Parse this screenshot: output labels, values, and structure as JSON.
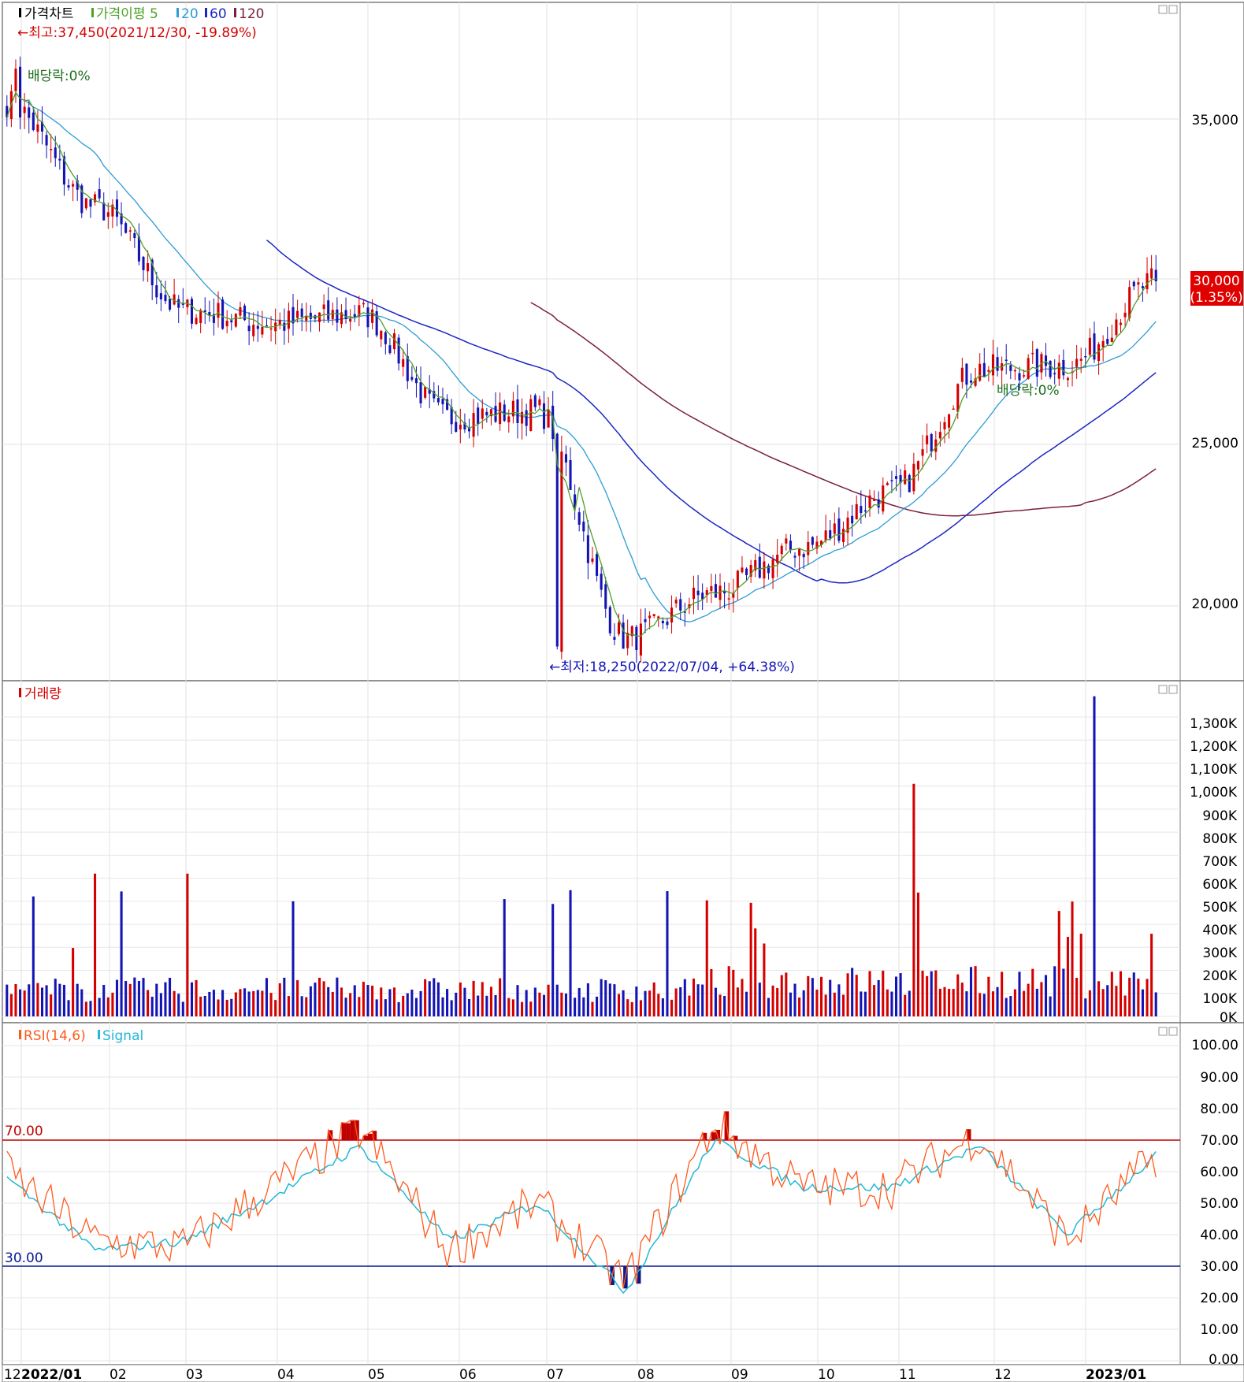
{
  "panes": {
    "price": {
      "title": "가격차트",
      "legend": [
        "가격이평 5",
        "20",
        "60",
        "120"
      ],
      "legend_colors": [
        "#4fa028",
        "#2e9bd6",
        "#1c25c4",
        "#7a1f3d"
      ],
      "high_note": "←최고:37,450(2021/12/30, -19.89%)",
      "low_note": "←최저:18,250(2022/07/04, +64.38%)",
      "dividend_note_1": "배당락:0%",
      "dividend_note_2": "배당락:0%",
      "current_price": "30,000",
      "current_change": "(1.35%)",
      "y_ticks": [
        "35,000",
        "25,000",
        "20,000"
      ]
    },
    "volume": {
      "title": "거래량",
      "y_ticks": [
        "1,300K",
        "1,200K",
        "1,100K",
        "1,000K",
        "900K",
        "800K",
        "700K",
        "600K",
        "500K",
        "400K",
        "300K",
        "200K",
        "100K",
        "0K"
      ]
    },
    "rsi": {
      "title": "RSI(14,6)",
      "signal_label": "Signal",
      "upper_label": "70.00",
      "lower_label": "30.00",
      "y_ticks": [
        "100.00",
        "90.00",
        "80.00",
        "70.00",
        "60.00",
        "50.00",
        "40.00",
        "30.00",
        "20.00",
        "10.00",
        "0.00"
      ]
    }
  },
  "x_axis": {
    "labels": [
      "12",
      "2022/01",
      "02",
      "03",
      "04",
      "05",
      "06",
      "07",
      "08",
      "09",
      "10",
      "11",
      "12",
      "2023/01"
    ]
  },
  "colors": {
    "up": "#d40000",
    "down": "#1414b4",
    "ma5": "#4fa028",
    "ma20": "#2e9bd6",
    "ma60": "#1c25c4",
    "ma120": "#7a1f3d",
    "rsi": "#ff5a1e",
    "signal": "#22b8d6",
    "overbought": "#c00000",
    "oversold": "#0a1a8c"
  },
  "chart_data": [
    {
      "type": "candlestick",
      "pane": "price",
      "unit": "KRW",
      "ylim": [
        18250,
        37450
      ],
      "annotations": {
        "high": 37450,
        "high_date": "2021/12/30",
        "low": 18250,
        "low_date": "2022/07/04",
        "last": 30000,
        "last_change_pct": 1.35
      },
      "close_path_monthly": [
        {
          "date": "2021/12",
          "close": 35500
        },
        {
          "date": "2022/01",
          "close": 32300
        },
        {
          "date": "2022/02",
          "close": 29100
        },
        {
          "date": "2022/03",
          "close": 28700
        },
        {
          "date": "2022/04",
          "close": 29000
        },
        {
          "date": "2022/05",
          "close": 25800
        },
        {
          "date": "2022/06",
          "close": 26000
        },
        {
          "date": "2022/07",
          "close": 19000
        },
        {
          "date": "2022/08",
          "close": 20400
        },
        {
          "date": "2022/09",
          "close": 21800
        },
        {
          "date": "2022/10",
          "close": 23500
        },
        {
          "date": "2022/11",
          "close": 27300
        },
        {
          "date": "2022/12",
          "close": 27400
        },
        {
          "date": "2023/01",
          "close": 30000
        }
      ]
    },
    {
      "type": "bar",
      "pane": "volume",
      "unit": "shares",
      "ylim": [
        0,
        1400000
      ],
      "notable_bars": [
        {
          "date": "2022/01",
          "value": 620000
        },
        {
          "date": "2022/03",
          "value": 620000
        },
        {
          "date": "2022/11",
          "value": 1010000
        },
        {
          "date": "2023/01",
          "value": 1390000
        }
      ]
    },
    {
      "type": "line",
      "pane": "rsi",
      "ylim": [
        0,
        100
      ],
      "levels": [
        70,
        30
      ],
      "series": [
        {
          "name": "RSI(14,6)",
          "monthly": [
            {
              "date": "2021/12",
              "value": 60
            },
            {
              "date": "2022/01",
              "value": 38
            },
            {
              "date": "2022/02",
              "value": 36
            },
            {
              "date": "2022/03",
              "value": 55
            },
            {
              "date": "2022/04",
              "value": 73
            },
            {
              "date": "2022/05",
              "value": 35
            },
            {
              "date": "2022/06",
              "value": 50
            },
            {
              "date": "2022/07",
              "value": 25
            },
            {
              "date": "2022/08",
              "value": 75
            },
            {
              "date": "2022/09",
              "value": 55
            },
            {
              "date": "2022/10",
              "value": 55
            },
            {
              "date": "2022/11",
              "value": 72
            },
            {
              "date": "2022/12",
              "value": 38
            },
            {
              "date": "2023/01",
              "value": 65
            }
          ]
        },
        {
          "name": "Signal",
          "monthly": [
            {
              "date": "2021/12",
              "value": 58
            },
            {
              "date": "2022/01",
              "value": 35
            },
            {
              "date": "2022/02",
              "value": 38
            },
            {
              "date": "2022/03",
              "value": 52
            },
            {
              "date": "2022/04",
              "value": 68
            },
            {
              "date": "2022/05",
              "value": 38
            },
            {
              "date": "2022/06",
              "value": 50
            },
            {
              "date": "2022/07",
              "value": 22
            },
            {
              "date": "2022/08",
              "value": 70
            },
            {
              "date": "2022/09",
              "value": 55
            },
            {
              "date": "2022/10",
              "value": 55
            },
            {
              "date": "2022/11",
              "value": 68
            },
            {
              "date": "2022/12",
              "value": 40
            },
            {
              "date": "2023/01",
              "value": 65
            }
          ]
        }
      ]
    }
  ]
}
